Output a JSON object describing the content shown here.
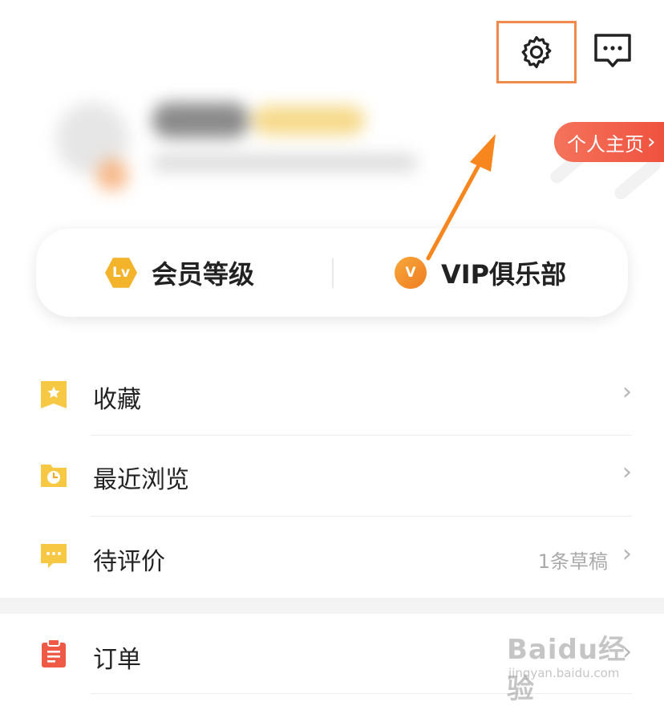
{
  "header": {
    "settings_icon": "gear-icon",
    "message_icon": "message-dots-icon"
  },
  "profile": {
    "homepage_label": "个人主页",
    "homepage_chevron": "›"
  },
  "member_card": {
    "level_badge": "Lv",
    "level_label": "会员等级",
    "vip_badge": "V",
    "vip_label": "VIP俱乐部"
  },
  "list": {
    "favorites_label": "收藏",
    "recent_label": "最近浏览",
    "review_label": "待评价",
    "review_extra": "1条草稿",
    "orders_label": "订单",
    "chevron": "›"
  },
  "watermark": {
    "main": "Baidu经验",
    "sub": "jingyan.baidu.com"
  },
  "colors": {
    "accent_orange": "#f08a4b",
    "homepage_red": "#ee4f3c",
    "icon_yellow": "#f7c843",
    "order_red": "#ef5a47"
  }
}
